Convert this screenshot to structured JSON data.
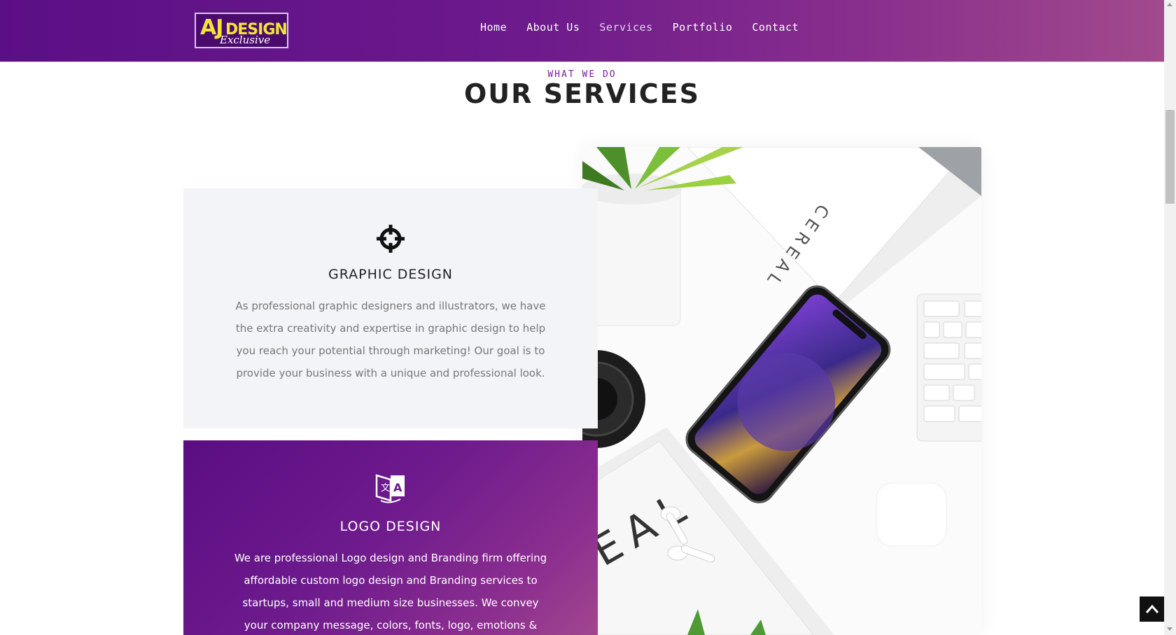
{
  "header": {
    "logo": {
      "main": "AJ",
      "word": "DESIGN",
      "sub": "Exclusive"
    },
    "nav": [
      {
        "label": "Home"
      },
      {
        "label": "About Us"
      },
      {
        "label": "Services",
        "active": true
      },
      {
        "label": "Portfolio"
      },
      {
        "label": "Contact"
      }
    ]
  },
  "section": {
    "kicker": "WHAT WE DO",
    "title": "OUR SERVICES"
  },
  "photo": {
    "book_text": "CEREAL",
    "magazine_text": "EAL"
  },
  "services": [
    {
      "icon": "crosshair-icon",
      "title": "GRAPHIC DESIGN",
      "text": "As professional graphic designers and illustrators, we have the extra creativity and expertise in graphic design to help you reach your potential through marketing! Our goal is to provide your business with a unique and professional look."
    },
    {
      "icon": "translate-icon",
      "title": "LOGO DESIGN",
      "text": "We are professional Logo design and Branding firm offering affordable custom logo design and Branding services to startups, small and medium size businesses. We convey your company message, colors, fonts, logo, emotions & target"
    }
  ],
  "colors": {
    "brand_purple": "#5b0f86",
    "brand_magenta": "#a24a8d",
    "logo_yellow": "#f3e43a",
    "card_light": "#f3f4f8"
  }
}
